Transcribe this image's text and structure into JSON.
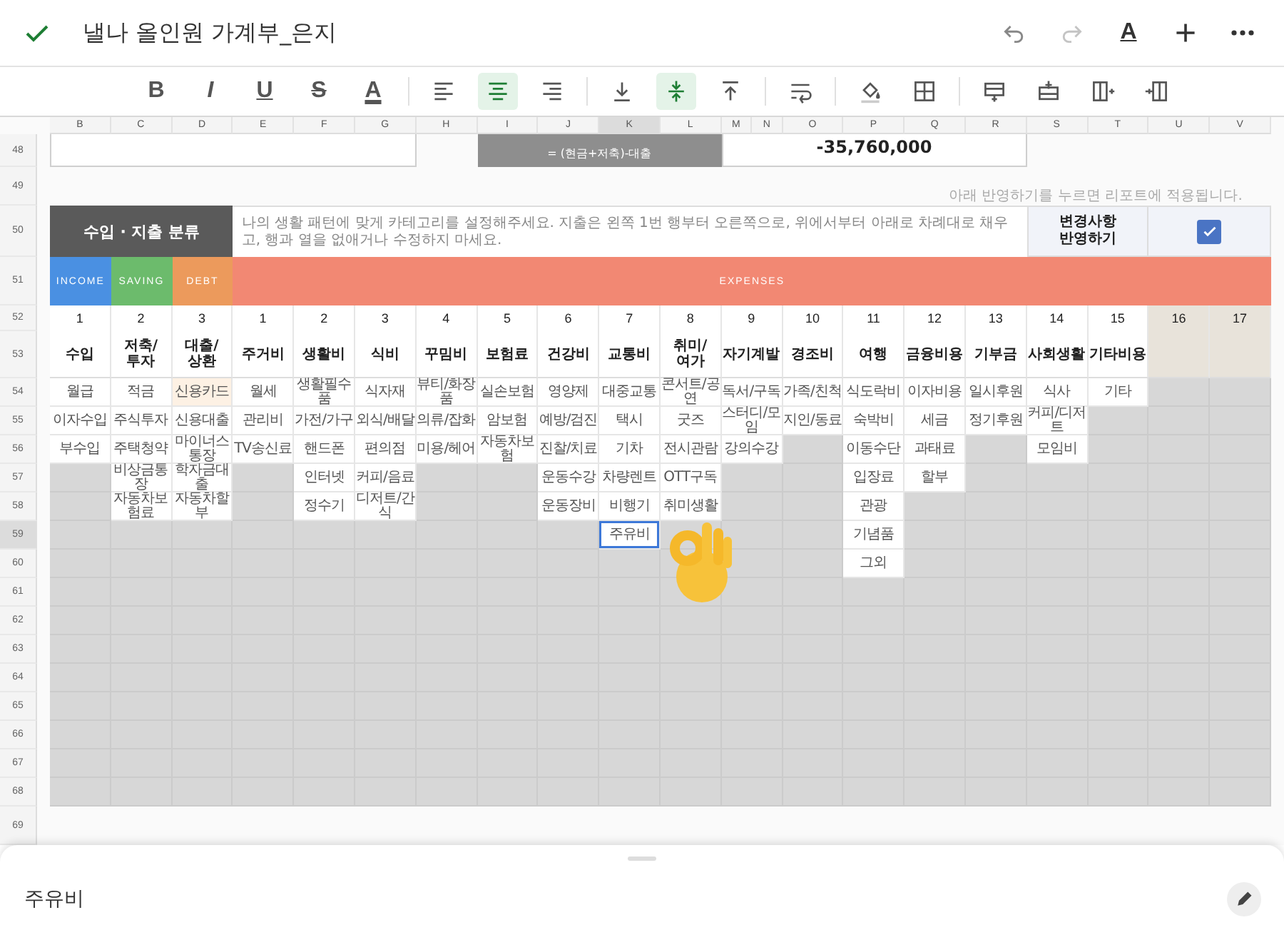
{
  "title": "낼나 올인원 가계부_은지",
  "top_actions": [
    {
      "kind": "undo",
      "disabled": false
    },
    {
      "kind": "redo",
      "disabled": true
    },
    {
      "kind": "format",
      "label": "A"
    },
    {
      "kind": "add"
    },
    {
      "kind": "more"
    }
  ],
  "toolbar": [
    [
      {
        "kind": "bold",
        "label": "B",
        "selected": false
      },
      {
        "kind": "italic",
        "label": "I",
        "selected": false
      },
      {
        "kind": "underline",
        "label": "U",
        "selected": false
      },
      {
        "kind": "strike",
        "label": "S",
        "selected": false
      },
      {
        "kind": "color",
        "label": "A",
        "selected": false
      }
    ],
    [
      {
        "kind": "align-left",
        "selected": false
      },
      {
        "kind": "align-center",
        "selected": true
      },
      {
        "kind": "align-right",
        "selected": false
      }
    ],
    [
      {
        "kind": "valign-bottom",
        "selected": false
      },
      {
        "kind": "valign-middle",
        "selected": true
      },
      {
        "kind": "valign-top",
        "selected": false
      }
    ],
    [
      {
        "kind": "wrap",
        "selected": false
      }
    ],
    [
      {
        "kind": "fill",
        "selected": false
      },
      {
        "kind": "borders",
        "selected": false
      }
    ],
    [
      {
        "kind": "row-above",
        "selected": false
      },
      {
        "kind": "row-below",
        "selected": false
      },
      {
        "kind": "col-right",
        "selected": false
      },
      {
        "kind": "col-left",
        "selected": false
      }
    ]
  ],
  "columns": [
    {
      "label": "B",
      "selected": false
    },
    {
      "label": "C",
      "selected": false
    },
    {
      "label": "D",
      "selected": false
    },
    {
      "label": "E",
      "selected": false
    },
    {
      "label": "F",
      "selected": false
    },
    {
      "label": "G",
      "selected": false
    },
    {
      "label": "H",
      "selected": false
    },
    {
      "label": "I",
      "selected": false
    },
    {
      "label": "J",
      "selected": false
    },
    {
      "label": "K",
      "selected": true
    },
    {
      "label": "L",
      "selected": false
    },
    {
      "label": "M",
      "selected": false
    },
    {
      "label": "N",
      "selected": false
    },
    {
      "label": "O",
      "selected": false
    },
    {
      "label": "P",
      "selected": false
    },
    {
      "label": "Q",
      "selected": false
    },
    {
      "label": "R",
      "selected": false
    },
    {
      "label": "S",
      "selected": false
    },
    {
      "label": "T",
      "selected": false
    },
    {
      "label": "U",
      "selected": false
    },
    {
      "label": "V",
      "selected": false
    }
  ],
  "rows": [
    {
      "label": "48",
      "selected": false
    },
    {
      "label": "49",
      "selected": false
    },
    {
      "label": "50",
      "selected": false
    },
    {
      "label": "51",
      "selected": false
    },
    {
      "label": "52",
      "selected": false
    },
    {
      "label": "53",
      "selected": false
    },
    {
      "label": "54",
      "selected": false
    },
    {
      "label": "55",
      "selected": false
    },
    {
      "label": "56",
      "selected": false
    },
    {
      "label": "57",
      "selected": false
    },
    {
      "label": "58",
      "selected": false
    },
    {
      "label": "59",
      "selected": true
    },
    {
      "label": "60",
      "selected": false
    },
    {
      "label": "61",
      "selected": false
    },
    {
      "label": "62",
      "selected": false
    },
    {
      "label": "63",
      "selected": false
    },
    {
      "label": "64",
      "selected": false
    },
    {
      "label": "65",
      "selected": false
    },
    {
      "label": "66",
      "selected": false
    },
    {
      "label": "67",
      "selected": false
    },
    {
      "label": "68",
      "selected": false
    },
    {
      "label": "69",
      "selected": false
    }
  ],
  "summary": {
    "formula": "= (현금+저축)-대출",
    "amount": "-35,760,000"
  },
  "note": "아래 반영하기를 누르면 리포트에 적용됩니다.",
  "classification": {
    "title": "수입 · 지출 분류",
    "description": "나의 생활 패턴에 맞게 카테고리를 설정해주세요. 지출은 왼쪽 1번 행부터 오른쪽으로, 위에서부터 아래로 차례대로 채우고, 행과 열을 없애거나 수정하지 마세요.",
    "apply_label": "변경사항 반영하기",
    "apply_checked": true
  },
  "groups": [
    {
      "label": "INCOME",
      "color": "#4a90e2",
      "categories": [
        {
          "number": "1",
          "name": "수입",
          "merged": false,
          "items": [
            {
              "text": "월급",
              "selected": false,
              "highlighted": false
            },
            {
              "text": "이자수입",
              "selected": false,
              "highlighted": false
            },
            {
              "text": "부수입",
              "selected": false,
              "highlighted": false
            }
          ]
        }
      ]
    },
    {
      "label": "SAVING",
      "color": "#6cbb6c",
      "categories": [
        {
          "number": "2",
          "name": "저축/투자",
          "merged": false,
          "items": [
            {
              "text": "적금",
              "selected": false,
              "highlighted": false
            },
            {
              "text": "주식투자",
              "selected": false,
              "highlighted": false
            },
            {
              "text": "주택청약",
              "selected": false,
              "highlighted": false
            },
            {
              "text": "비상금통장",
              "selected": false,
              "highlighted": false
            },
            {
              "text": "자동차보험료",
              "selected": false,
              "highlighted": false
            }
          ]
        }
      ]
    },
    {
      "label": "DEBT",
      "color": "#ec9a5c",
      "categories": [
        {
          "number": "3",
          "name": "대출/상환",
          "merged": false,
          "items": [
            {
              "text": "신용카드",
              "selected": false,
              "highlighted": true
            },
            {
              "text": "신용대출",
              "selected": false,
              "highlighted": false
            },
            {
              "text": "마이너스통장",
              "selected": false,
              "highlighted": false
            },
            {
              "text": "학자금대출",
              "selected": false,
              "highlighted": false
            },
            {
              "text": "자동차할부",
              "selected": false,
              "highlighted": false
            }
          ]
        }
      ]
    },
    {
      "label": "EXPENSES",
      "color": "#f28873",
      "categories": [
        {
          "number": "1",
          "name": "주거비",
          "merged": false,
          "items": [
            {
              "text": "월세",
              "selected": false,
              "highlighted": false
            },
            {
              "text": "관리비",
              "selected": false,
              "highlighted": false
            },
            {
              "text": "TV송신료",
              "selected": false,
              "highlighted": false
            }
          ]
        },
        {
          "number": "2",
          "name": "생활비",
          "merged": false,
          "items": [
            {
              "text": "생활필수품",
              "selected": false,
              "highlighted": false
            },
            {
              "text": "가전/가구",
              "selected": false,
              "highlighted": false
            },
            {
              "text": "핸드폰",
              "selected": false,
              "highlighted": false
            },
            {
              "text": "인터넷",
              "selected": false,
              "highlighted": false
            },
            {
              "text": "정수기",
              "selected": false,
              "highlighted": false
            }
          ]
        },
        {
          "number": "3",
          "name": "식비",
          "merged": false,
          "items": [
            {
              "text": "식자재",
              "selected": false,
              "highlighted": false
            },
            {
              "text": "외식/배달",
              "selected": false,
              "highlighted": false
            },
            {
              "text": "편의점",
              "selected": false,
              "highlighted": false
            },
            {
              "text": "커피/음료",
              "selected": false,
              "highlighted": false
            },
            {
              "text": "디저트/간식",
              "selected": false,
              "highlighted": false
            }
          ]
        },
        {
          "number": "4",
          "name": "꾸밈비",
          "merged": false,
          "items": [
            {
              "text": "뷰티/화장품",
              "selected": false,
              "highlighted": false
            },
            {
              "text": "의류/잡화",
              "selected": false,
              "highlighted": false
            },
            {
              "text": "미용/헤어",
              "selected": false,
              "highlighted": false
            }
          ]
        },
        {
          "number": "5",
          "name": "보험료",
          "merged": false,
          "items": [
            {
              "text": "실손보험",
              "selected": false,
              "highlighted": false
            },
            {
              "text": "암보험",
              "selected": false,
              "highlighted": false
            },
            {
              "text": "자동차보험",
              "selected": false,
              "highlighted": false
            }
          ]
        },
        {
          "number": "6",
          "name": "건강비",
          "merged": false,
          "items": [
            {
              "text": "영양제",
              "selected": false,
              "highlighted": false
            },
            {
              "text": "예방/검진",
              "selected": false,
              "highlighted": false
            },
            {
              "text": "진찰/치료",
              "selected": false,
              "highlighted": false
            },
            {
              "text": "운동수강",
              "selected": false,
              "highlighted": false
            },
            {
              "text": "운동장비",
              "selected": false,
              "highlighted": false
            }
          ]
        },
        {
          "number": "7",
          "name": "교통비",
          "merged": false,
          "items": [
            {
              "text": "대중교통",
              "selected": false,
              "highlighted": false
            },
            {
              "text": "택시",
              "selected": false,
              "highlighted": false
            },
            {
              "text": "기차",
              "selected": false,
              "highlighted": false
            },
            {
              "text": "차량렌트",
              "selected": false,
              "highlighted": false
            },
            {
              "text": "비행기",
              "selected": false,
              "highlighted": false
            },
            {
              "text": "주유비",
              "selected": true,
              "highlighted": false
            }
          ]
        },
        {
          "number": "8",
          "name": "취미/여가",
          "merged": false,
          "items": [
            {
              "text": "콘서트/공연",
              "selected": false,
              "highlighted": false
            },
            {
              "text": "굿즈",
              "selected": false,
              "highlighted": false
            },
            {
              "text": "전시관람",
              "selected": false,
              "highlighted": false
            },
            {
              "text": "OTT구독",
              "selected": false,
              "highlighted": false
            },
            {
              "text": "취미생활",
              "selected": false,
              "highlighted": false
            }
          ]
        },
        {
          "number": "9",
          "name": "자기계발",
          "merged": true,
          "items": [
            {
              "text": "독서/구독",
              "selected": false,
              "highlighted": false
            },
            {
              "text": "스터디/모임",
              "selected": false,
              "highlighted": false
            },
            {
              "text": "강의수강",
              "selected": false,
              "highlighted": false
            }
          ]
        },
        {
          "number": "10",
          "name": "경조비",
          "merged": false,
          "items": [
            {
              "text": "가족/친척",
              "selected": false,
              "highlighted": false
            },
            {
              "text": "지인/동료",
              "selected": false,
              "highlighted": false
            }
          ]
        },
        {
          "number": "11",
          "name": "여행",
          "merged": false,
          "items": [
            {
              "text": "식도락비",
              "selected": false,
              "highlighted": false
            },
            {
              "text": "숙박비",
              "selected": false,
              "highlighted": false
            },
            {
              "text": "이동수단",
              "selected": false,
              "highlighted": false
            },
            {
              "text": "입장료",
              "selected": false,
              "highlighted": false
            },
            {
              "text": "관광",
              "selected": false,
              "highlighted": false
            },
            {
              "text": "기념품",
              "selected": false,
              "highlighted": false
            },
            {
              "text": "그외",
              "selected": false,
              "highlighted": false
            }
          ]
        },
        {
          "number": "12",
          "name": "금융비용",
          "merged": false,
          "items": [
            {
              "text": "이자비용",
              "selected": false,
              "highlighted": false
            },
            {
              "text": "세금",
              "selected": false,
              "highlighted": false
            },
            {
              "text": "과태료",
              "selected": false,
              "highlighted": false
            },
            {
              "text": "할부",
              "selected": false,
              "highlighted": false
            }
          ]
        },
        {
          "number": "13",
          "name": "기부금",
          "merged": false,
          "items": [
            {
              "text": "일시후원",
              "selected": false,
              "highlighted": false
            },
            {
              "text": "정기후원",
              "selected": false,
              "highlighted": false
            }
          ]
        },
        {
          "number": "14",
          "name": "사회생활",
          "merged": false,
          "items": [
            {
              "text": "식사",
              "selected": false,
              "highlighted": false
            },
            {
              "text": "커피/디저트",
              "selected": false,
              "highlighted": false
            },
            {
              "text": "모임비",
              "selected": false,
              "highlighted": false
            }
          ]
        },
        {
          "number": "15",
          "name": "기타비용",
          "merged": false,
          "items": [
            {
              "text": "기타",
              "selected": false,
              "highlighted": false
            }
          ]
        },
        {
          "number": "16",
          "merged": false
        },
        {
          "number": "17",
          "merged": false
        }
      ]
    }
  ],
  "cell_editor": {
    "value": "주유비"
  }
}
